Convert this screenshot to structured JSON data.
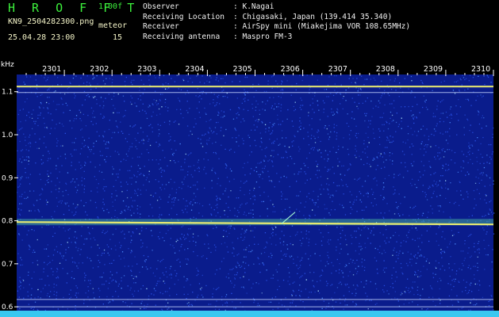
{
  "header": {
    "brand": "H R O F F T",
    "version": "1.00f",
    "filename": "KN9_2504282300.png",
    "meteor_label": "meteor",
    "datetime": "25.04.28 23:00",
    "meteor_count": "15",
    "meta": [
      {
        "key": "Observer",
        "sep": ":",
        "value": "K.Nagai"
      },
      {
        "key": "Receiving Location",
        "sep": ":",
        "value": "Chigasaki, Japan (139.414 35.340)"
      },
      {
        "key": "Receiver",
        "sep": ":",
        "value": "AirSpy mini (Miakejima VOR 108.65MHz)"
      },
      {
        "key": "Receiving antenna",
        "sep": ":",
        "value": "Maspro FM-3"
      }
    ]
  },
  "chart_data": {
    "type": "heatmap",
    "ylabel": "kHz",
    "y_ticks": [
      "1.1",
      "1.0",
      "0.9",
      "0.8",
      "0.7",
      "0.6"
    ],
    "ylim": [
      0.58,
      1.14
    ],
    "x_ticks": [
      "2301",
      "2302",
      "2303",
      "2304",
      "2305",
      "2306",
      "2307",
      "2308",
      "2309",
      "2310"
    ],
    "bands_khz": [
      1.112,
      1.098,
      0.797,
      0.617,
      0.6,
      0.583
    ],
    "colors": {
      "background": "#0a1c8c",
      "noise": "#2a52e8",
      "band": "#f0f070"
    }
  }
}
